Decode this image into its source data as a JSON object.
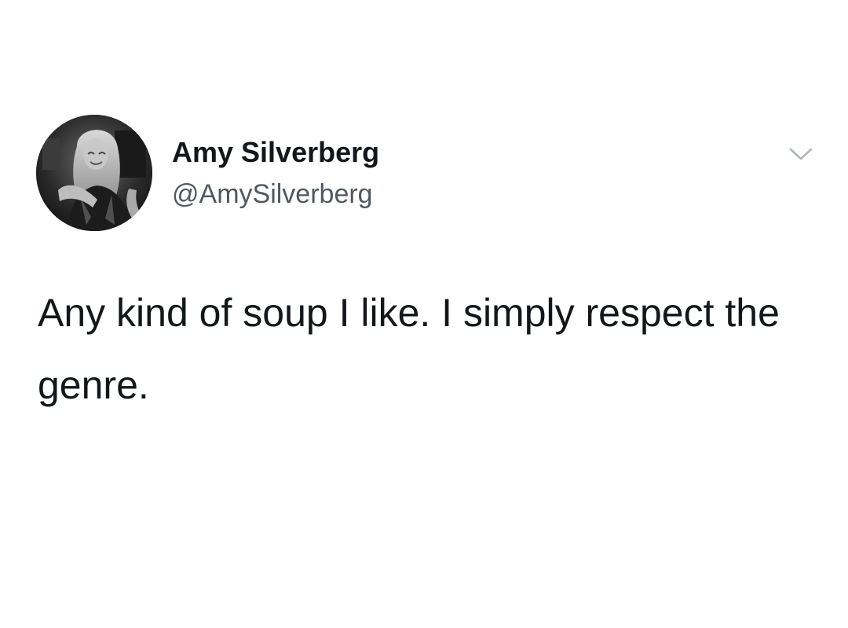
{
  "tweet": {
    "author": {
      "display_name": "Amy Silverberg",
      "handle": "@AmySilverberg",
      "avatar_icon": "profile-photo"
    },
    "text": "Any kind of soup I like. I simply respect the genre.",
    "menu_icon": "chevron-down-icon"
  },
  "colors": {
    "background": "#ffffff",
    "text_primary": "#14171a",
    "text_secondary": "#4f5960",
    "chevron": "#b0b6bb"
  }
}
